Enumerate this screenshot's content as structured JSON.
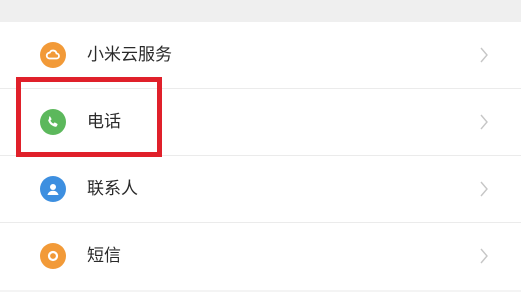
{
  "settings_list": {
    "items": [
      {
        "label": "小米云服务",
        "icon": "cloud-icon",
        "icon_color": "#f29a38"
      },
      {
        "label": "电话",
        "icon": "phone-icon",
        "icon_color": "#5cb85c"
      },
      {
        "label": "联系人",
        "icon": "contacts-icon",
        "icon_color": "#3d8fe0"
      },
      {
        "label": "短信",
        "icon": "message-icon",
        "icon_color": "#f29a38"
      }
    ]
  },
  "annotation": {
    "highlight_color": "#e0202a"
  }
}
